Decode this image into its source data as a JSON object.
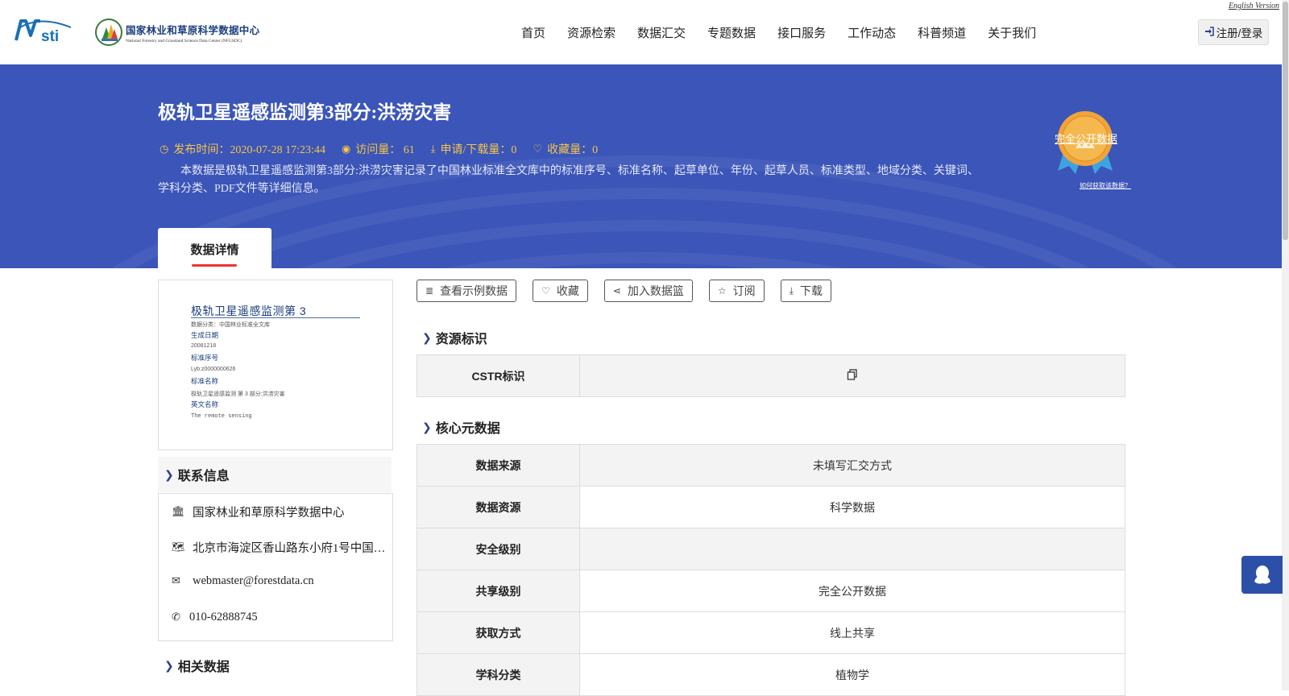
{
  "header": {
    "english_link": "English Version",
    "logo_nsti": "Nsti",
    "center_name_cn": "国家林业和草原科学数据中心",
    "center_name_en": "National Forestry and Grassland Science Data Center (NFGSDC)",
    "nav": [
      "首页",
      "资源检索",
      "数据汇交",
      "专题数据",
      "接口服务",
      "工作动态",
      "科普频道",
      "关于我们"
    ],
    "login_label": "注册/登录"
  },
  "dataset": {
    "title": "极轨卫星遥感监测第3部分:洪涝灾害",
    "publish_time": "发布时间：2020-07-28 17:23:44",
    "visits": "访问量： 61",
    "downloads": "申请/下载量：0",
    "favorites": "收藏量：0",
    "description": "本数据是极轨卫星遥感监测第3部分:洪涝灾害记录了中国林业标准全文库中的标准序号、标准名称、起草单位、年份、起草人员、标准类型、地域分类、关键词、学科分类、PDF文件等详细信息。",
    "badge_text": "完全公开数据",
    "badge_link": "如何获取该数据？",
    "tab_label": "数据详情"
  },
  "thumbnail": {
    "title": "极轨卫星遥感监测第 3",
    "subtitle": "数据分类：中国林业标准全文库",
    "h1": "生成日期",
    "v1": "20081218",
    "h2": "标准序号",
    "v2": "Lyb:z0000000626",
    "h3": "标准名称",
    "v3": "极轨卫星遥感监测 第 3 部分:洪涝灾害",
    "h4": "英文名称",
    "v4": "The remote sensing"
  },
  "contact": {
    "heading": "联系信息",
    "org": "国家林业和草原科学数据中心",
    "address": "北京市海淀区香山路东小府1号中国…",
    "email": "webmaster@forestdata.cn",
    "phone": "010-62888745"
  },
  "related": {
    "heading": "相关数据"
  },
  "actions": {
    "sample": "查看示例数据",
    "favorite": "收藏",
    "basket": "加入数据篮",
    "subscribe": "订阅",
    "download": "下载"
  },
  "resource_id": {
    "heading": "资源标识",
    "cstr_label": "CSTR标识",
    "cstr_value": ""
  },
  "core_metadata": {
    "heading": "核心元数据",
    "rows": [
      {
        "key": "数据来源",
        "value": "未填写汇交方式"
      },
      {
        "key": "数据资源",
        "value": "科学数据"
      },
      {
        "key": "安全级别",
        "value": ""
      },
      {
        "key": "共享级别",
        "value": "完全公开数据"
      },
      {
        "key": "获取方式",
        "value": "线上共享"
      },
      {
        "key": "学科分类",
        "value": "植物学"
      }
    ]
  },
  "colors": {
    "banner": "#3b55b9",
    "meta_text": "#f5c547",
    "accent": "#2c3e90",
    "tab_underline": "#ee3333"
  }
}
